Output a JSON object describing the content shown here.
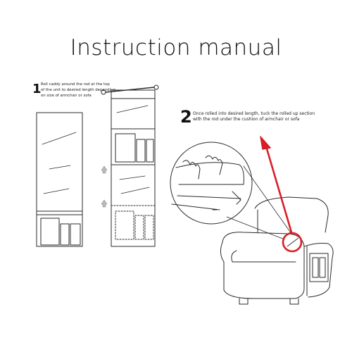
{
  "title": "Instruction manual",
  "steps": [
    {
      "number": "1",
      "text_lines": [
        "Roll caddy around the rod at the top",
        "of the unit to desired length depending",
        "on size of armchair or sofa"
      ]
    },
    {
      "number": "2",
      "text_lines": [
        "Once rolled into desired length, tuck the rolled up section",
        "with the rod under the cushion of armchair or sofa"
      ]
    }
  ],
  "colors": {
    "line": "#2a2a2a",
    "accent": "#d81f26"
  },
  "icons": [
    "up-arrow-icon",
    "red-arrow-icon",
    "highlight-circle-icon"
  ]
}
